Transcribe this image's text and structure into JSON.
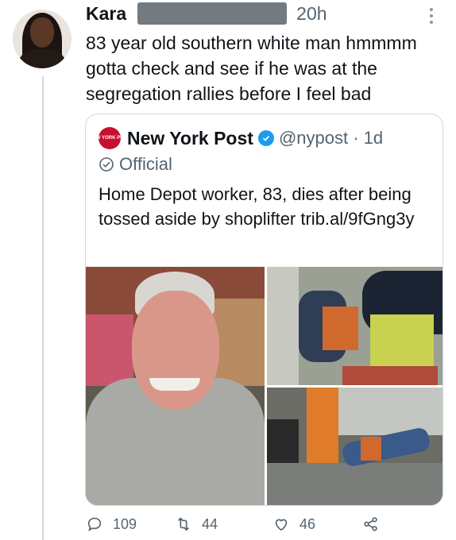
{
  "tweet": {
    "author_name": "Kara",
    "time": "20h",
    "text": "83 year old southern white man hmmmm gotta check and see if he was at the segregation rallies before I feel bad"
  },
  "quoted_tweet": {
    "logo_text": "NEW YORK POST",
    "author_name": "New York Post",
    "handle_time": "@nypost · 1d",
    "label": "Official",
    "text": "Home Depot worker, 83, dies after being tossed aside by shoplifter trib.al/9fGng3y"
  },
  "actions": {
    "replies": "109",
    "retweets": "44",
    "likes": "46"
  },
  "colors": {
    "verified": "#1d9bf0",
    "nyp_red": "#c8102e",
    "muted": "#536471"
  }
}
